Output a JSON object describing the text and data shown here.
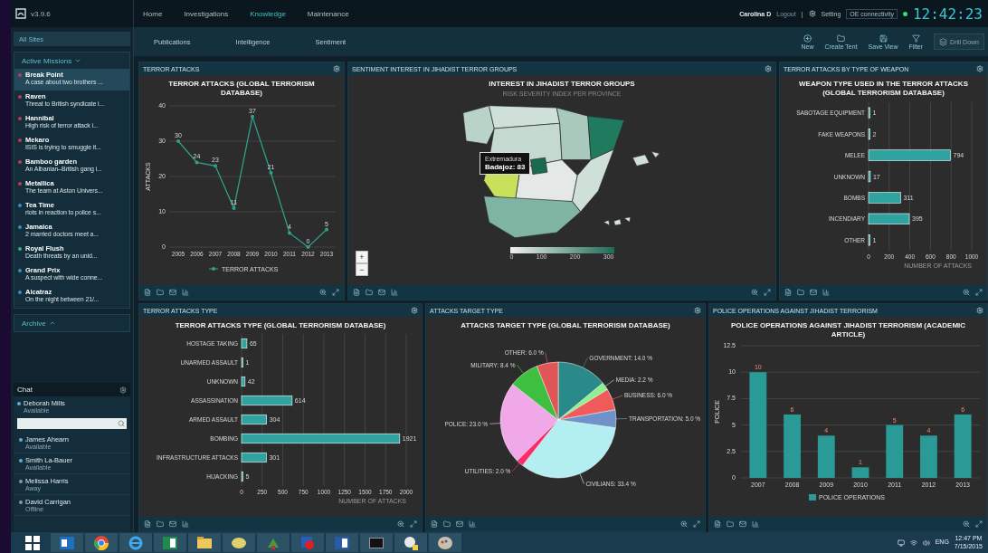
{
  "app": {
    "version": "v3.9.6"
  },
  "header": {
    "nav": [
      {
        "label": "Home",
        "selected": false
      },
      {
        "label": "Investigations",
        "selected": false
      },
      {
        "label": "Knowledge",
        "selected": true
      },
      {
        "label": "Maintenance",
        "selected": false
      }
    ],
    "user": "Carolina D",
    "logout": "Logout",
    "separator": "|",
    "settings": "Setting",
    "connectivity": "OE connectivity",
    "connected": true,
    "clock": "12:42:23"
  },
  "subnav": {
    "tabs": [
      "Publications",
      "Intelligence",
      "Sentiment"
    ],
    "actions": [
      {
        "label": "New",
        "kind": "new",
        "disabled": false
      },
      {
        "label": "Create Tent",
        "kind": "folder",
        "disabled": false
      },
      {
        "label": "Save View",
        "kind": "save",
        "disabled": false
      },
      {
        "label": "Filter",
        "kind": "filter",
        "disabled": false
      },
      {
        "label": "Drill Down",
        "kind": "drill",
        "disabled": true
      }
    ]
  },
  "sidebar": {
    "all_sites": "All Sites",
    "missions_header": "Active Missions",
    "missions_expanded": true,
    "missions": [
      {
        "name": "Break Point",
        "summary": "A case about two brothers ...",
        "color": "#c0395a",
        "selected": true
      },
      {
        "name": "Raven",
        "summary": "Threat to British syndicate i...",
        "color": "#c0395a",
        "selected": false
      },
      {
        "name": "Hannibal",
        "summary": "High risk of terror attack i...",
        "color": "#c0395a",
        "selected": false
      },
      {
        "name": "Mekaro",
        "summary": "ISIS is trying to smuggle it...",
        "color": "#c0395a",
        "selected": false
      },
      {
        "name": "Bamboo garden",
        "summary": "An Albanian–British gang i...",
        "color": "#c0395a",
        "selected": false
      },
      {
        "name": "Metallica",
        "summary": "The team at Aston Univers...",
        "color": "#c0395a",
        "selected": false
      },
      {
        "name": "Tea Time",
        "summary": "riots in reaction to police s...",
        "color": "#3a8fc0",
        "selected": false
      },
      {
        "name": "Jamaica",
        "summary": "2 married doctors meet a...",
        "color": "#3a8fc0",
        "selected": false
      },
      {
        "name": "Royal Flush",
        "summary": "Death threats by an unid...",
        "color": "#2fb38f",
        "selected": false
      },
      {
        "name": "Grand Prix",
        "summary": "A suspect with wide conne...",
        "color": "#3a8fc0",
        "selected": false
      },
      {
        "name": "Alcatraz",
        "summary": "On the night between 21/...",
        "color": "#3a8fc0",
        "selected": false
      }
    ],
    "archive": "Archive",
    "archive_expanded": false
  },
  "chat": {
    "title": "Chat",
    "user": "Deborah Mills",
    "status": "Available",
    "contacts": [
      {
        "name": "James Ahearn",
        "status": "Available",
        "color": "#5fb0d0"
      },
      {
        "name": "Smith La-Bauer",
        "status": "Available",
        "color": "#5fb0d0"
      },
      {
        "name": "Melissa Harris",
        "status": "Away",
        "color": "#8a9aa2"
      },
      {
        "name": "David Carrigan",
        "status": "Offline",
        "color": "#8a9aa2"
      }
    ]
  },
  "panels": [
    {
      "header": "TERROR ATTACKS",
      "chart_data": {
        "type": "line",
        "title": "TERROR ATTACKS (GLOBAL TERRORISM DATABASE)",
        "ylabel": "ATTACKS",
        "categories": [
          "2005",
          "2006",
          "2007",
          "2008",
          "2009",
          "2010",
          "2011",
          "2012",
          "2013"
        ],
        "series": [
          {
            "name": "TERROR ATTACKS",
            "color": "#2fa08a",
            "values": [
              30,
              24,
              23,
              11,
              37,
              21,
              4,
              0,
              5
            ]
          }
        ],
        "ylim": [
          0,
          40
        ],
        "yticks": [
          0,
          10,
          20,
          30,
          40
        ],
        "grid": true,
        "data_labels": true
      }
    },
    {
      "header": "SENTIMENT INTEREST IN JIHADIST TERROR GROUPS",
      "kind": "map",
      "title": "INTEREST IN JIHADIST TERROR GROUPS",
      "subtitle": "RISK SEVERITY INDEX PER PROVINCE",
      "tooltip": {
        "region": "Extremadura",
        "value": "Badajoz: 83"
      },
      "legend": [
        "0",
        "100",
        "200",
        "300"
      ],
      "zoom": [
        "+",
        "−"
      ]
    },
    {
      "header": "TERROR ATTACKS BY TYPE OF WEAPON",
      "chart_data": {
        "type": "bar",
        "orientation": "horizontal",
        "title": "WEAPON TYPE USED IN THE TERROR ATTACKS (GLOBAL TERRORISM DATABASE)",
        "xlabel": "NUMBER OF ATTACKS",
        "categories": [
          "SABOTAGE EQUIPMENT",
          "FAKE WEAPONS",
          "MELEE",
          "UNKNOWN",
          "BOMBS",
          "INCENDIARY",
          "OTHER"
        ],
        "series": [
          {
            "color": "#2fa3a0",
            "values": [
              1,
              2,
              794,
              17,
              311,
              395,
              1
            ]
          }
        ],
        "xlim": [
          0,
          1000
        ],
        "xticks": [
          0,
          200,
          400,
          600,
          800,
          1000
        ],
        "grid": true,
        "data_labels": true
      }
    },
    {
      "header": "TERROR ATTACKS TYPE",
      "chart_data": {
        "type": "bar",
        "orientation": "horizontal",
        "title": "TERROR ATTACKS TYPE (GLOBAL TERRORISM DATABASE)",
        "xlabel": "NUMBER OF ATTACKS",
        "categories": [
          "HOSTAGE TAKING",
          "UNARMED ASSAULT",
          "UNKNOWN",
          "ASSASSINATION",
          "ARMED ASSAULT",
          "BOMBING",
          "INFRASTRUCTURE ATTACKS",
          "HIJACKING"
        ],
        "series": [
          {
            "color": "#2fa3a0",
            "values": [
              65,
              1,
              42,
              614,
              304,
              1921,
              301,
              5
            ]
          }
        ],
        "xlim": [
          0,
          2000
        ],
        "xticks": [
          0,
          250,
          500,
          750,
          1000,
          1250,
          1500,
          1750,
          2000
        ],
        "grid": true,
        "data_labels": true
      }
    },
    {
      "header": "ATTACKS TARGET TYPE",
      "chart_data": {
        "type": "pie",
        "title": "ATTACKS TARGET TYPE (GLOBAL TERRORISM DATABASE)",
        "categories": [
          "GOVERNMENT: 14.0 %",
          "MEDIA: 2.2 %",
          "BUSINESS: 6.0 %",
          "TRANSPORTATION: 5.0 %",
          "CIVILIANS: 33.4 %",
          "UTILITIES: 2.0 %",
          "POLICE: 23.0 %",
          "MILITARY: 8.4 %",
          "OTHER: 6.0 %"
        ],
        "series": [
          {
            "values": [
              14.0,
              2.2,
              6.0,
              5.0,
              33.4,
              2.0,
              23.0,
              8.4,
              6.0
            ]
          }
        ],
        "colors": [
          "#2a8a8a",
          "#8ef08e",
          "#f05a5a",
          "#6f93c8",
          "#b3eef0",
          "#ff2a6a",
          "#f0a8e8",
          "#3fbf3f",
          "#e05555"
        ]
      }
    },
    {
      "header": "POLICE OPERATIONS AGAINST JIHADIST TERRORISM",
      "chart_data": {
        "type": "bar",
        "orientation": "vertical",
        "title": "POLICE OPERATIONS AGAINST JIHADIST TERRORISM (ACADEMIC ARTICLE)",
        "ylabel": "POLICE",
        "categories": [
          "2007",
          "2008",
          "2009",
          "2010",
          "2011",
          "2012",
          "2013"
        ],
        "series": [
          {
            "name": "POLICE OPERATIONS",
            "color": "#2a9a96",
            "values": [
              10,
              6,
              4,
              1,
              5,
              4,
              6
            ]
          }
        ],
        "ylim": [
          0,
          12.5
        ],
        "yticks": [
          0,
          2.5,
          5,
          7.5,
          10,
          12.5
        ],
        "grid": true,
        "data_labels": true
      }
    }
  ],
  "taskbar": {
    "apps": [
      {
        "kind": "windows"
      },
      {
        "kind": "outlook"
      },
      {
        "kind": "chrome"
      },
      {
        "kind": "ie"
      },
      {
        "kind": "excel"
      },
      {
        "kind": "explorer"
      },
      {
        "kind": "cloud"
      },
      {
        "kind": "tree"
      },
      {
        "kind": "record"
      },
      {
        "kind": "word"
      },
      {
        "kind": "terminal"
      },
      {
        "kind": "magnifier"
      },
      {
        "kind": "paint"
      }
    ],
    "language": "ENG",
    "time": "12:47 PM",
    "date": "7/15/2015"
  }
}
